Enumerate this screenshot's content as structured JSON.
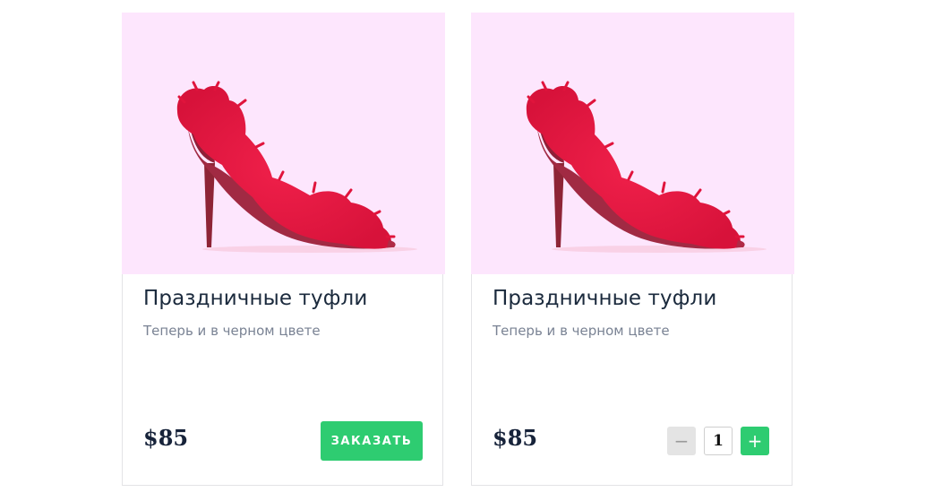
{
  "products": [
    {
      "title": "Праздничные туфли",
      "subtitle": "Теперь и в черном цвете",
      "price": "$85",
      "image": "red-feather-heel-image",
      "order_label": "ЗАКАЗАТЬ"
    },
    {
      "title": "Праздничные туфли",
      "subtitle": "Теперь и в черном цвете",
      "price": "$85",
      "image": "red-feather-heel-image",
      "quantity": "1",
      "minus_label": "−",
      "plus_label": "+"
    }
  ],
  "colors": {
    "accent": "#2ecc71",
    "image_background": "#fde6fd",
    "title_text": "#1b2a3d",
    "subtitle_text": "#7a8394"
  }
}
